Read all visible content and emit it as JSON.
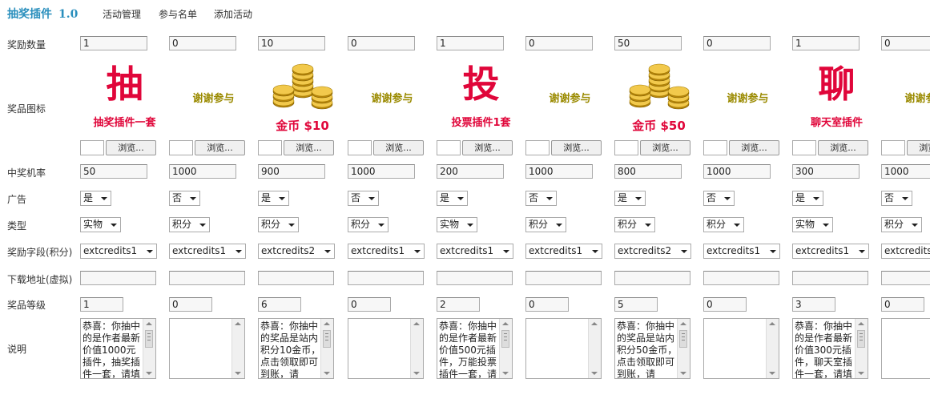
{
  "header": {
    "title": "抽奖插件",
    "version": "1.0",
    "nav": [
      "活动管理",
      "参与名单",
      "添加活动"
    ]
  },
  "row_labels": {
    "count": "奖励数量",
    "icon": "奖品图标",
    "probability": "中奖机率",
    "ad": "广告",
    "type": "类型",
    "field": "奖励字段(积分)",
    "download": "下载地址(虚拟)",
    "level": "奖品等级",
    "desc": "说明"
  },
  "browse_label": "浏览...",
  "colors": {
    "accent": "#2a8fbd",
    "prize_red": "#e0063a",
    "thanks_gold": "#9a8a00"
  },
  "prizes": [
    {
      "count": "1",
      "image": {
        "kind": "char",
        "char": "抽",
        "caption": "抽奖插件一套"
      },
      "probability": "50",
      "ad": "是",
      "type": "实物",
      "field": "extcredits1",
      "download": "",
      "level": "1",
      "desc": "恭喜：你抽中的是作者最新价值1000元插件，抽奖插件一套，请填"
    },
    {
      "count": "0",
      "image": {
        "kind": "thanks",
        "caption": "谢谢参与"
      },
      "probability": "1000",
      "ad": "否",
      "type": "积分",
      "field": "extcredits1",
      "download": "",
      "level": "0",
      "desc": ""
    },
    {
      "count": "10",
      "image": {
        "kind": "coins",
        "caption": "金币 $10"
      },
      "probability": "900",
      "ad": "是",
      "type": "积分",
      "field": "extcredits2",
      "download": "",
      "level": "6",
      "desc": "恭喜：你抽中的奖品是站内积分10金币，点击领取即可到账，请"
    },
    {
      "count": "0",
      "image": {
        "kind": "thanks",
        "caption": "谢谢参与"
      },
      "probability": "1000",
      "ad": "否",
      "type": "积分",
      "field": "extcredits1",
      "download": "",
      "level": "0",
      "desc": ""
    },
    {
      "count": "1",
      "image": {
        "kind": "char",
        "char": "投",
        "caption": "投票插件1套"
      },
      "probability": "200",
      "ad": "是",
      "type": "实物",
      "field": "extcredits1",
      "download": "",
      "level": "2",
      "desc": "恭喜：你抽中的是作者最新价值500元插件，万能投票插件一套，请"
    },
    {
      "count": "0",
      "image": {
        "kind": "thanks",
        "caption": "谢谢参与"
      },
      "probability": "1000",
      "ad": "否",
      "type": "积分",
      "field": "extcredits1",
      "download": "",
      "level": "0",
      "desc": ""
    },
    {
      "count": "50",
      "image": {
        "kind": "coins",
        "caption": "金币 $50"
      },
      "probability": "800",
      "ad": "是",
      "type": "积分",
      "field": "extcredits2",
      "download": "",
      "level": "5",
      "desc": "恭喜：你抽中的奖品是站内积分50金币，点击领取即可到账，请"
    },
    {
      "count": "0",
      "image": {
        "kind": "thanks",
        "caption": "谢谢参与"
      },
      "probability": "1000",
      "ad": "否",
      "type": "积分",
      "field": "extcredits1",
      "download": "",
      "level": "0",
      "desc": ""
    },
    {
      "count": "1",
      "image": {
        "kind": "char",
        "char": "聊",
        "caption": "聊天室插件"
      },
      "probability": "300",
      "ad": "是",
      "type": "实物",
      "field": "extcredits1",
      "download": "",
      "level": "3",
      "desc": "恭喜：你抽中的是作者最新价值300元插件，聊天室插件一套，请填"
    },
    {
      "count": "0",
      "image": {
        "kind": "thanks",
        "caption": "谢谢参与"
      },
      "probability": "1000",
      "ad": "否",
      "type": "积分",
      "field": "extcredits1",
      "download": "",
      "level": "0",
      "desc": ""
    }
  ]
}
